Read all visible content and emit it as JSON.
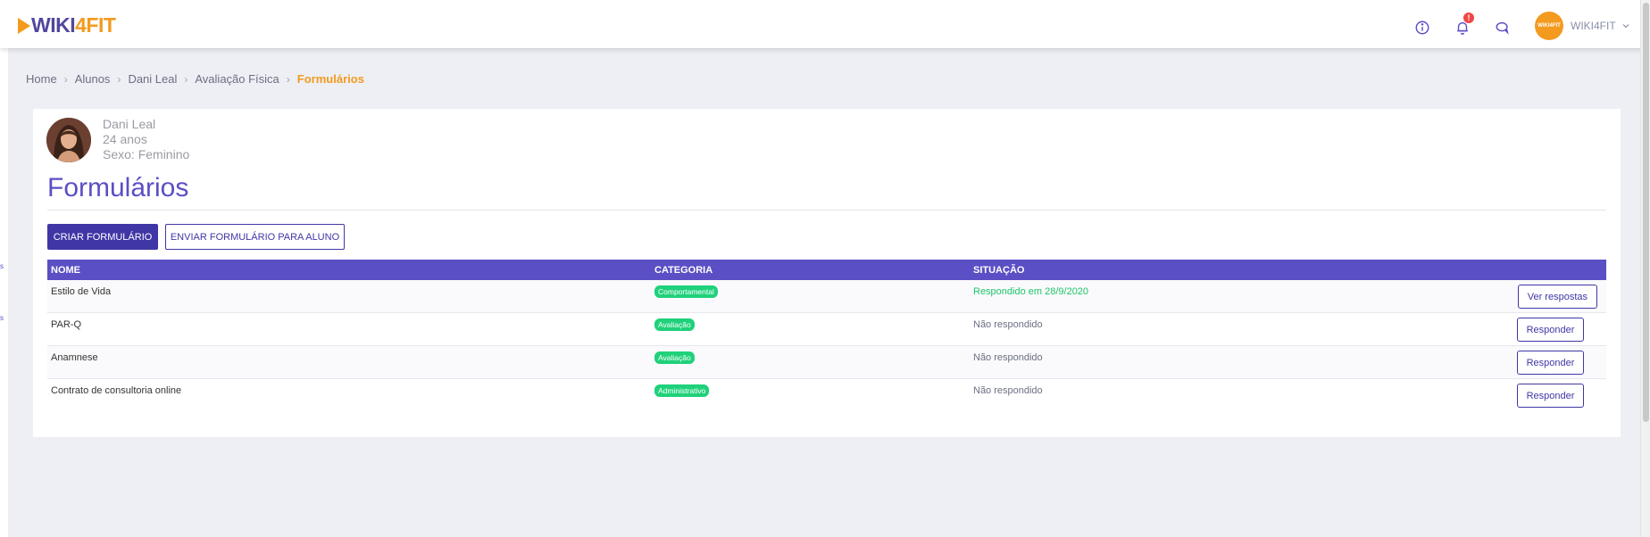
{
  "brand": {
    "prefix": "WIKI",
    "highlight": "4FIT"
  },
  "header": {
    "icons": [
      "info-icon",
      "bell-icon",
      "chat-icon"
    ],
    "notification_count": "!",
    "user": {
      "name": "WIKI4FIT",
      "avatar_text": "WIKI4FIT"
    }
  },
  "breadcrumb": [
    {
      "label": "Home"
    },
    {
      "label": "Alunos"
    },
    {
      "label": "Dani Leal"
    },
    {
      "label": "Avaliação Física"
    },
    {
      "label": "Formulários"
    }
  ],
  "profile": {
    "name": "Dani Leal",
    "age": "24 anos",
    "sex": "Sexo: Feminino"
  },
  "page": {
    "title": "Formulários",
    "create_button": "CRIAR FORMULÁRIO",
    "send_button": "ENVIAR FORMULÁRIO PARA ALUNO"
  },
  "table": {
    "headers": {
      "name": "NOME",
      "category": "CATEGORIA",
      "status": "SITUAÇÃO"
    },
    "rows": [
      {
        "name": "Estilo de Vida",
        "category": "Comportamental",
        "status": "Respondido em 28/9/2020",
        "action": "Ver respostas"
      },
      {
        "name": "PAR-Q",
        "category": "Avaliação",
        "status": "Não respondido",
        "action": "Responder"
      },
      {
        "name": "Anamnese",
        "category": "Avaliação",
        "status": "Não respondido",
        "action": "Responder"
      },
      {
        "name": "Contrato de consultoria online",
        "category": "Administrativo",
        "status": "Não respondido",
        "action": "Responder"
      }
    ]
  },
  "colors": {
    "brand_purple": "#5a4fc4",
    "button_purple": "#3f37a6",
    "brand_orange": "#f39a1f",
    "success_green": "#1fd17a",
    "background": "#edeff4"
  }
}
